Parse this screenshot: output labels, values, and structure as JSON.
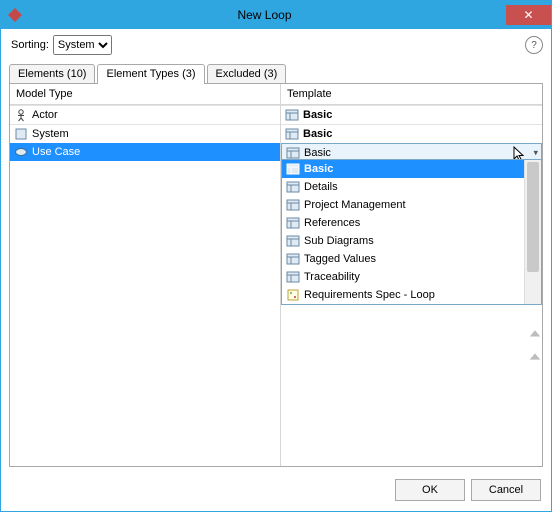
{
  "title": "New Loop",
  "sorting_label": "Sorting:",
  "sorting_value": "System",
  "sorting_options": [
    "System"
  ],
  "tabs": [
    {
      "label": "Elements (10)",
      "active": false
    },
    {
      "label": "Element Types (3)",
      "active": true
    },
    {
      "label": "Excluded (3)",
      "active": false
    }
  ],
  "columns": {
    "model": "Model Type",
    "template": "Template"
  },
  "rows": [
    {
      "model": "Actor",
      "template": "Basic",
      "bold": true,
      "icon": "actor",
      "selected": false
    },
    {
      "model": "System",
      "template": "Basic",
      "bold": true,
      "icon": "system",
      "selected": false
    },
    {
      "model": "Use Case",
      "template": "Basic",
      "bold": false,
      "icon": "usecase",
      "selected": true
    }
  ],
  "dropdown_items": [
    {
      "label": "Basic",
      "selected": true
    },
    {
      "label": "Details"
    },
    {
      "label": "Project Management"
    },
    {
      "label": "References"
    },
    {
      "label": "Sub Diagrams"
    },
    {
      "label": "Tagged Values"
    },
    {
      "label": "Traceability"
    },
    {
      "label": "Requirements Spec - Loop",
      "special_icon": true
    }
  ],
  "buttons": {
    "ok": "OK",
    "cancel": "Cancel"
  }
}
